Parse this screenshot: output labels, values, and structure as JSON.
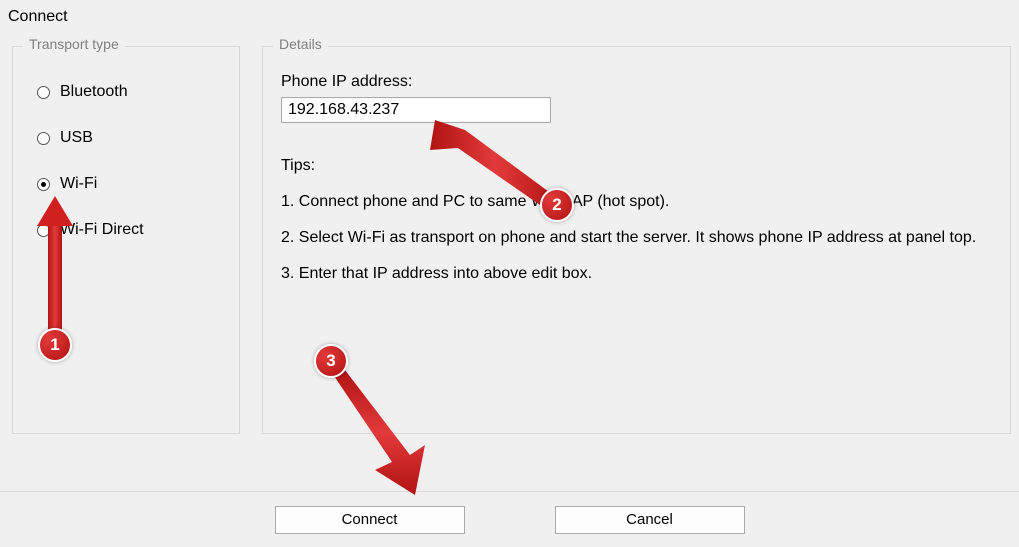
{
  "window": {
    "title": "Connect"
  },
  "transport": {
    "legend": "Transport type",
    "options": {
      "bluetooth": "Bluetooth",
      "usb": "USB",
      "wifi": "Wi-Fi",
      "wifi_direct": "Wi-Fi Direct"
    },
    "selected": "wifi"
  },
  "details": {
    "legend": "Details",
    "ip_label": "Phone IP address:",
    "ip_value": "192.168.43.237",
    "tips_heading": "Tips:",
    "tips": {
      "1": "1. Connect phone and PC to same Wi-Fi AP (hot spot).",
      "2": "2. Select Wi-Fi as transport on phone and start the server. It shows phone IP address at panel top.",
      "3": "3. Enter that IP address into above edit box."
    }
  },
  "footer": {
    "connect": "Connect",
    "cancel": "Cancel"
  },
  "annotations": {
    "badge1": "1",
    "badge2": "2",
    "badge3": "3",
    "color": "#d02020"
  }
}
